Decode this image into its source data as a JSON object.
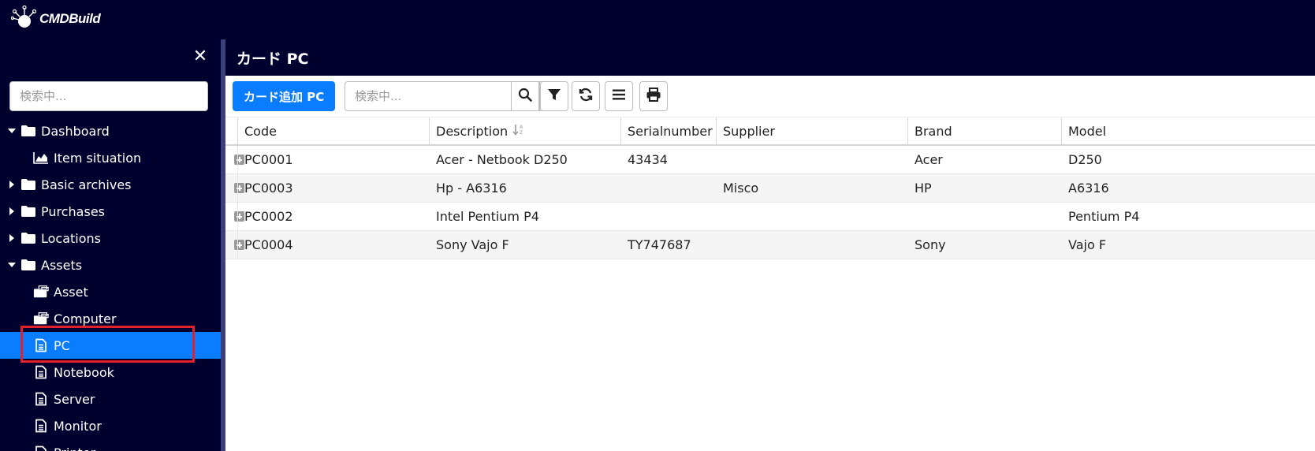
{
  "app": {
    "logo_text": "CMDBuild"
  },
  "sidebar": {
    "search_placeholder": "検索中...",
    "collapse_symbol": "✕",
    "tree": [
      {
        "label": "Dashboard",
        "icon": "folder-icon",
        "level": 0,
        "expanded": true
      },
      {
        "label": "Item situation",
        "icon": "area-chart-icon",
        "level": 1
      },
      {
        "label": "Basic archives",
        "icon": "folder-icon",
        "level": 0,
        "expanded": false
      },
      {
        "label": "Purchases",
        "icon": "folder-icon",
        "level": 0,
        "expanded": false
      },
      {
        "label": "Locations",
        "icon": "folder-icon",
        "level": 0,
        "expanded": false
      },
      {
        "label": "Assets",
        "icon": "folder-icon",
        "level": 0,
        "expanded": true
      },
      {
        "label": "Asset",
        "icon": "class-stack-icon",
        "level": 1
      },
      {
        "label": "Computer",
        "icon": "class-stack-icon",
        "level": 1
      },
      {
        "label": "PC",
        "icon": "file-text-icon",
        "level": 1,
        "selected": true
      },
      {
        "label": "Notebook",
        "icon": "file-text-icon",
        "level": 1
      },
      {
        "label": "Server",
        "icon": "file-text-icon",
        "level": 1
      },
      {
        "label": "Monitor",
        "icon": "file-text-icon",
        "level": 1
      },
      {
        "label": "Printer",
        "icon": "file-text-icon",
        "level": 1
      }
    ]
  },
  "main": {
    "title": "カード PC",
    "toolbar": {
      "add_label": "カード追加 PC",
      "search_placeholder": "検索中...",
      "buttons": [
        "search-icon",
        "clear-icon",
        "filter-icon",
        "refresh-icon",
        "menu-icon",
        "print-icon"
      ]
    },
    "grid": {
      "columns": [
        "Code",
        "Description",
        "Serialnumber",
        "Supplier",
        "Brand",
        "Model"
      ],
      "sorted_column": "Description",
      "rows": [
        [
          "PC0001",
          "Acer - Netbook D250",
          "43434",
          "",
          "Acer",
          "D250"
        ],
        [
          "PC0003",
          "Hp - A6316",
          "",
          "Misco",
          "HP",
          "A6316"
        ],
        [
          "PC0002",
          "Intel Pentium P4",
          "",
          "",
          "",
          "Pentium P4"
        ],
        [
          "PC0004",
          "Sony Vajo F",
          "TY747687",
          "",
          "Sony",
          "Vajo F"
        ]
      ]
    }
  },
  "colors": {
    "header_bg": "#00002e",
    "accent": "#0a7cff",
    "selection_outline": "#e0202a"
  }
}
